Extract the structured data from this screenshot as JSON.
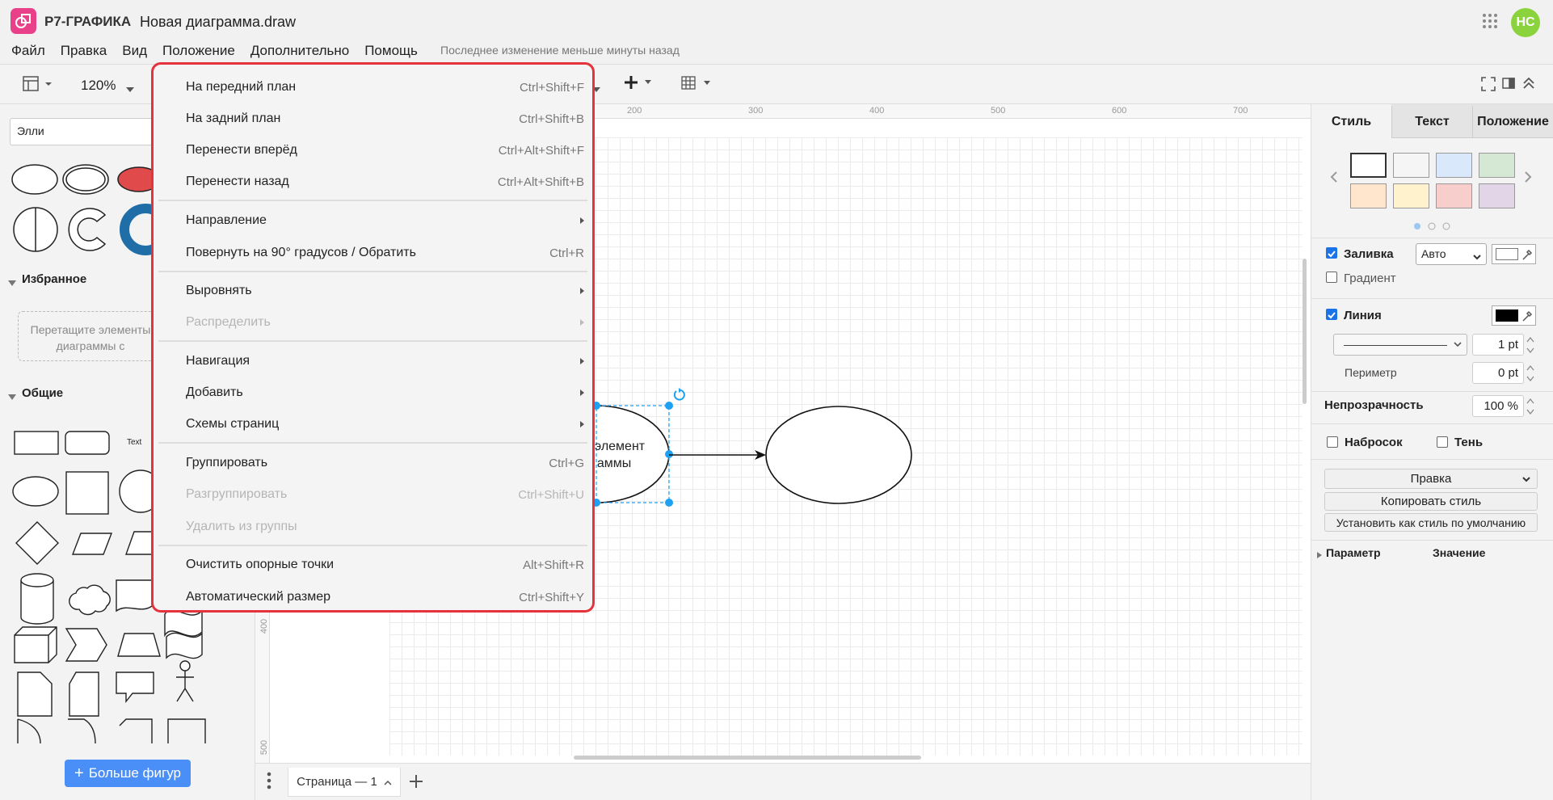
{
  "app": {
    "brand": "Р7-ГРАФИКА",
    "title": "Новая диаграмма.draw",
    "avatar_initials": "НС",
    "accent_color": "#e8418a",
    "avatar_color": "#8bd33c"
  },
  "menubar": {
    "items": [
      "Файл",
      "Правка",
      "Вид",
      "Положение",
      "Дополнительно",
      "Помощь"
    ],
    "last_modified": "Последнее изменение меньше минуты назад"
  },
  "toolbar": {
    "zoom": "120%"
  },
  "left_panel": {
    "search_value": "Элли",
    "favorites_title": "Избранное",
    "dropzone_text": "Перетащите элементы диаграммы с",
    "general_title": "Общие",
    "text_shape_label": "Text",
    "more_shapes": "Больше фигур"
  },
  "ruler": {
    "top_labels": [
      "200",
      "300",
      "400",
      "500",
      "600",
      "700"
    ],
    "left_labels": [
      "400",
      "500"
    ]
  },
  "diagram": {
    "shape1_text_line1": "элемент",
    "shape1_text_line2": "аммы"
  },
  "bottom": {
    "page_tab": "Страница — 1"
  },
  "right_panel": {
    "tabs": [
      "Стиль",
      "Текст",
      "Положение"
    ],
    "fill_label": "Заливка",
    "fill_value": "Авто",
    "gradient_label": "Градиент",
    "line_label": "Линия",
    "line_width": "1 pt",
    "perimeter_label": "Периметр",
    "perimeter_value": "0 pt",
    "opacity_label": "Непрозрачность",
    "opacity_value": "100 %",
    "sketch_label": "Набросок",
    "shadow_label": "Тень",
    "edit_button": "Правка",
    "copy_style_button": "Копировать стиль",
    "set_default_button": "Установить как стиль по умолчанию",
    "param_col": "Параметр",
    "value_col": "Значение"
  },
  "context_menu": {
    "items": [
      {
        "label": "На передний план",
        "shortcut": "Ctrl+Shift+F"
      },
      {
        "label": "На задний план",
        "shortcut": "Ctrl+Shift+B"
      },
      {
        "label": "Перенести вперёд",
        "shortcut": "Ctrl+Alt+Shift+F"
      },
      {
        "label": "Перенести назад",
        "shortcut": "Ctrl+Alt+Shift+B"
      },
      {
        "label": "Направление",
        "shortcut": ""
      },
      {
        "label": "Повернуть на 90° градусов / Обратить",
        "shortcut": "Ctrl+R"
      },
      {
        "label": "Выровнять",
        "shortcut": ""
      },
      {
        "label": "Распределить",
        "shortcut": ""
      },
      {
        "label": "Навигация",
        "shortcut": ""
      },
      {
        "label": "Добавить",
        "shortcut": ""
      },
      {
        "label": "Схемы страниц",
        "shortcut": ""
      },
      {
        "label": "Группировать",
        "shortcut": "Ctrl+G"
      },
      {
        "label": "Разгруппировать",
        "shortcut": "Ctrl+Shift+U"
      },
      {
        "label": "Удалить из группы",
        "shortcut": ""
      },
      {
        "label": "Очистить опорные точки",
        "shortcut": "Alt+Shift+R"
      },
      {
        "label": "Автоматический размер",
        "shortcut": "Ctrl+Shift+Y"
      }
    ]
  }
}
